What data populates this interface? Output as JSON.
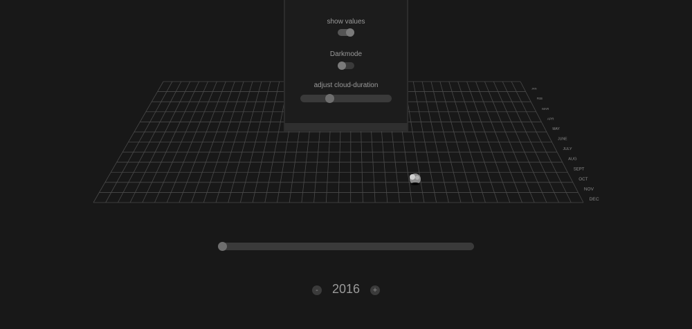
{
  "settings": {
    "show_values_label": "show values",
    "darkmode_label": "Darkmode",
    "cloud_duration_label": "adjust cloud-duration",
    "show_values_on": true,
    "darkmode_on": false,
    "cloud_duration_fraction": 0.3
  },
  "grid": {
    "months": [
      "JAN",
      "FEB",
      "MAR",
      "APR",
      "MAY",
      "JUNE",
      "JULY",
      "AUG",
      "SEPT",
      "OCT",
      "NOV",
      "DEC"
    ]
  },
  "timeline": {
    "year_fraction": 0.0,
    "year": "2016",
    "minus_label": "-",
    "plus_label": "+"
  },
  "colors": {
    "background": "#181818",
    "grid_line": "#4a4a4a",
    "toggle_on": "#555555",
    "toggle_off": "#3a3a3a"
  },
  "icons": {
    "cloud": "cloud-icon"
  }
}
